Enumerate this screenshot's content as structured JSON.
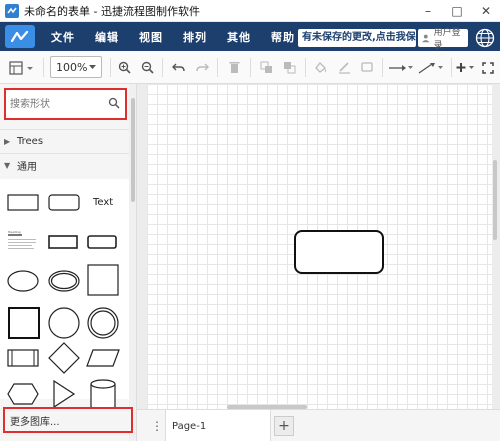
{
  "window": {
    "title": "未命名的表单 - 迅捷流程图制作软件",
    "controls": [
      "minimize",
      "maximize",
      "close"
    ]
  },
  "menubar": {
    "items": [
      "文件",
      "编辑",
      "视图",
      "排列",
      "其他",
      "帮助"
    ],
    "unsaved_notice": "有未保存的更改,点击我保存",
    "login_label": "用户登录",
    "bg_color": "#1d3f6e"
  },
  "toolbar": {
    "zoom": "100%",
    "icons": [
      "page-view-icon",
      "zoom-in-icon",
      "zoom-out-icon",
      "undo-icon",
      "redo-icon",
      "delete-icon",
      "to-front-icon",
      "to-back-icon",
      "fill-color-icon",
      "line-color-icon",
      "shadow-icon",
      "connection-icon",
      "waypoint-icon",
      "insert-icon",
      "fullscreen-icon"
    ]
  },
  "sidebar": {
    "search_placeholder": "搜索形状",
    "sections": [
      {
        "label": "Trees",
        "expanded": false
      },
      {
        "label": "通用",
        "expanded": true
      }
    ],
    "text_shape_label": "Text",
    "heading_shape_label": "Heading",
    "more_libraries": "更多图库..."
  },
  "pages": {
    "current": "Page-1",
    "add_label": "+"
  },
  "colors": {
    "accent": "#3a8ee6",
    "highlight_border": "#e02d2d"
  }
}
